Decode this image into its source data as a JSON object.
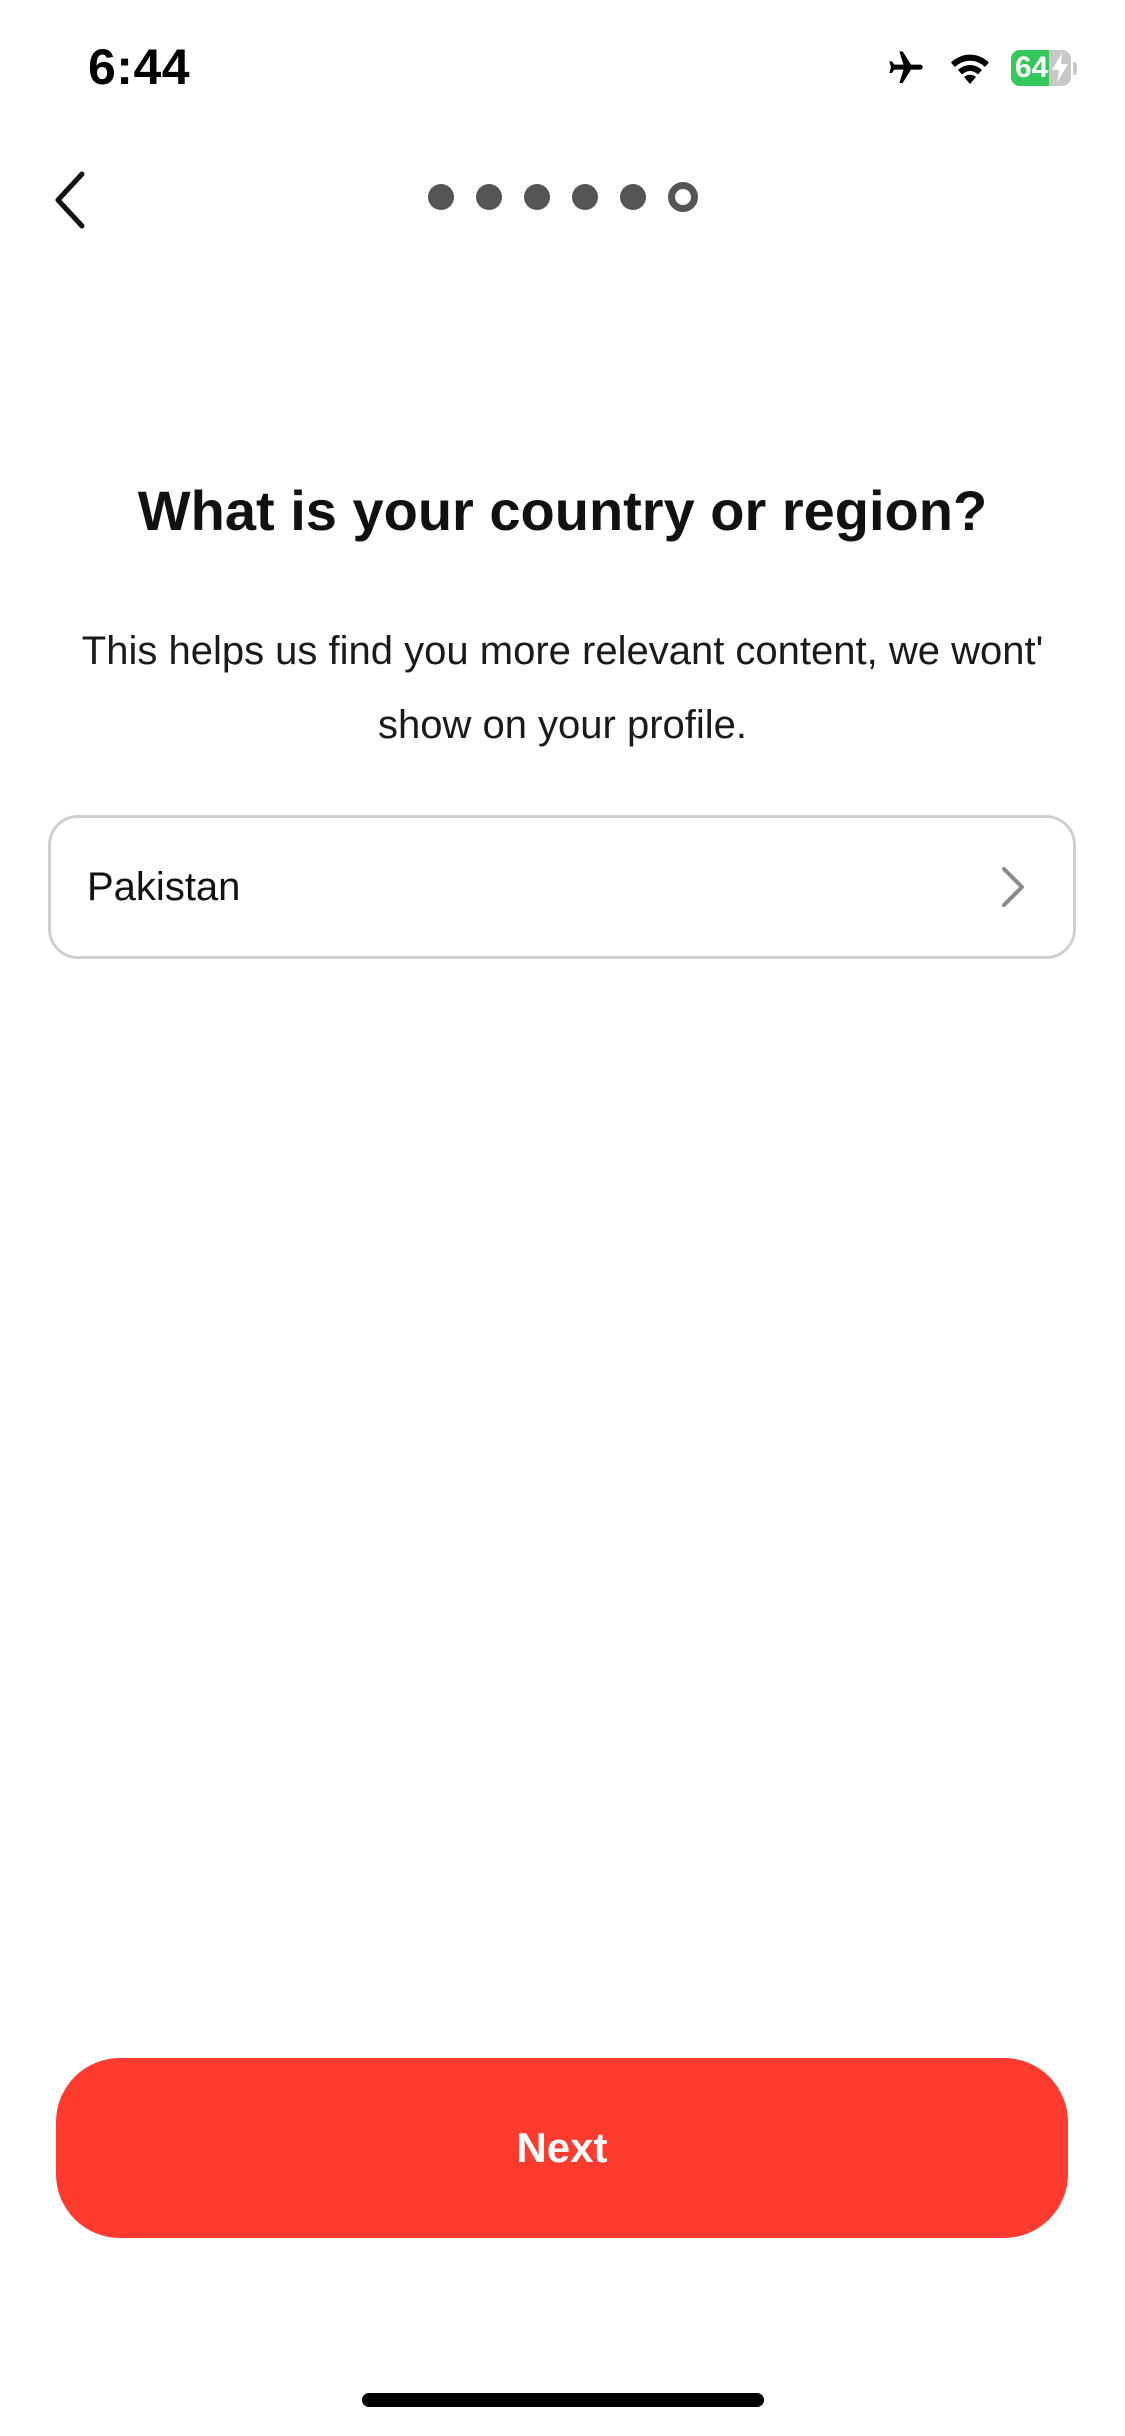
{
  "status_bar": {
    "time": "6:44",
    "battery_level": "64",
    "battery_fraction": 0.64,
    "icons": [
      "airplane-mode-icon",
      "wifi-icon",
      "battery-charging-icon"
    ]
  },
  "nav": {
    "back_icon": "chevron-left-icon",
    "progress": {
      "total_steps": 6,
      "current_step": 6
    }
  },
  "main": {
    "title": "What is your country or region?",
    "subtitle": "This helps us find you more relevant content, we wont' show on your profile.",
    "country_field": {
      "value": "Pakistan",
      "icon": "chevron-right-icon"
    }
  },
  "footer": {
    "next_label": "Next"
  },
  "colors": {
    "accent": "#ff3b30",
    "battery_green": "#34c759",
    "dot": "#555555",
    "field_border": "#cfcfcf"
  }
}
